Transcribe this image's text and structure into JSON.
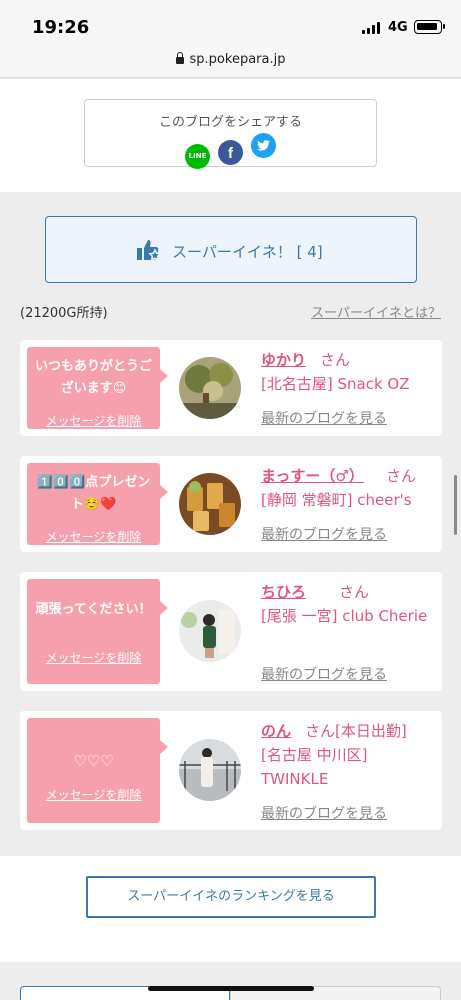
{
  "status_bar": {
    "time": "19:26",
    "network": "4G"
  },
  "browser": {
    "url": "sp.pokepara.jp"
  },
  "share": {
    "title": "このブログをシェアする",
    "line_label": "LINE",
    "facebook_label": "f"
  },
  "super_iine": {
    "label": "スーパーイイネ！ [ 4]",
    "points": "(21200G所持)",
    "about_link": "スーパーイイネとは？"
  },
  "cards": [
    {
      "message": "いつもありがとうございます😊",
      "delete_label": "メッセージを削除",
      "name": "ゆかり",
      "honorific": "さん",
      "shop": "[北名古屋] Snack OZ",
      "blog_link": "最新のブログを見る"
    },
    {
      "message": "1️⃣0️⃣0️⃣点プレゼント☺️❤️",
      "delete_label": "メッセージを削除",
      "name": "まっすー（♂）",
      "honorific": "さん",
      "shop": "[静岡 常磐町] cheer's",
      "blog_link": "最新のブログを見る"
    },
    {
      "message": "頑張ってください！",
      "delete_label": "メッセージを削除",
      "name": "ちひろ",
      "honorific": "さん",
      "shop": "[尾張 一宮] club Cherie",
      "blog_link": "最新のブログを見る"
    },
    {
      "message": "♡♡♡",
      "delete_label": "メッセージを削除",
      "name": "のん",
      "honorific": "さん[本日出勤]",
      "shop": "[名古屋 中川区] TWINKLE",
      "blog_link": "最新のブログを見る"
    }
  ],
  "ranking": {
    "button_label": "スーパーイイネのランキングを見る"
  },
  "colors": {
    "accent_blue": "#3a7aaa",
    "pink_text": "#e0567b",
    "bubble_pink": "#f7a0ad",
    "line_green": "#00b900",
    "facebook_blue": "#3b5998",
    "twitter_blue": "#1da1f2"
  }
}
